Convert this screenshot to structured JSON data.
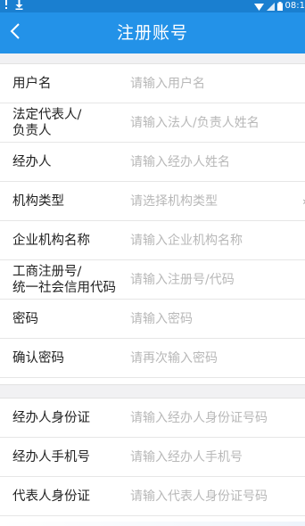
{
  "status_bar": {
    "time": "08:1",
    "download_icon": "download-icon",
    "warning_icon": "warning-icon"
  },
  "header": {
    "title": "注册账号",
    "back_icon": "chevron-left-icon"
  },
  "section_one": {
    "rows": [
      {
        "label": "用户名",
        "placeholder": "请输入用户名"
      },
      {
        "label": "法定代表人/\n负责人",
        "placeholder": "请输入法人/负责人姓名"
      },
      {
        "label": "经办人",
        "placeholder": "请输入经办人姓名"
      },
      {
        "label": "机构类型",
        "placeholder": "请选择机构类型"
      },
      {
        "label": "企业机构名称",
        "placeholder": "请输入企业机构名称"
      },
      {
        "label": "工商注册号/\n统一社会信用代码",
        "placeholder": "请输入注册号/代码"
      },
      {
        "label": "密码",
        "placeholder": "请输入密码"
      },
      {
        "label": "确认密码",
        "placeholder": "请再次输入密码"
      }
    ]
  },
  "section_two": {
    "rows": [
      {
        "label": "经办人身份证",
        "placeholder": "请输入经办人身份证号码"
      },
      {
        "label": "经办人手机号",
        "placeholder": "请输入经办人手机号"
      },
      {
        "label": "代表人身份证",
        "placeholder": "请输入代表人身份证号码"
      }
    ]
  },
  "colors": {
    "nav_bar": "#2392e8",
    "status_bar": "#1a7fd0",
    "placeholder": "#b8b8b8",
    "section_gap": "#f1f1f3"
  }
}
